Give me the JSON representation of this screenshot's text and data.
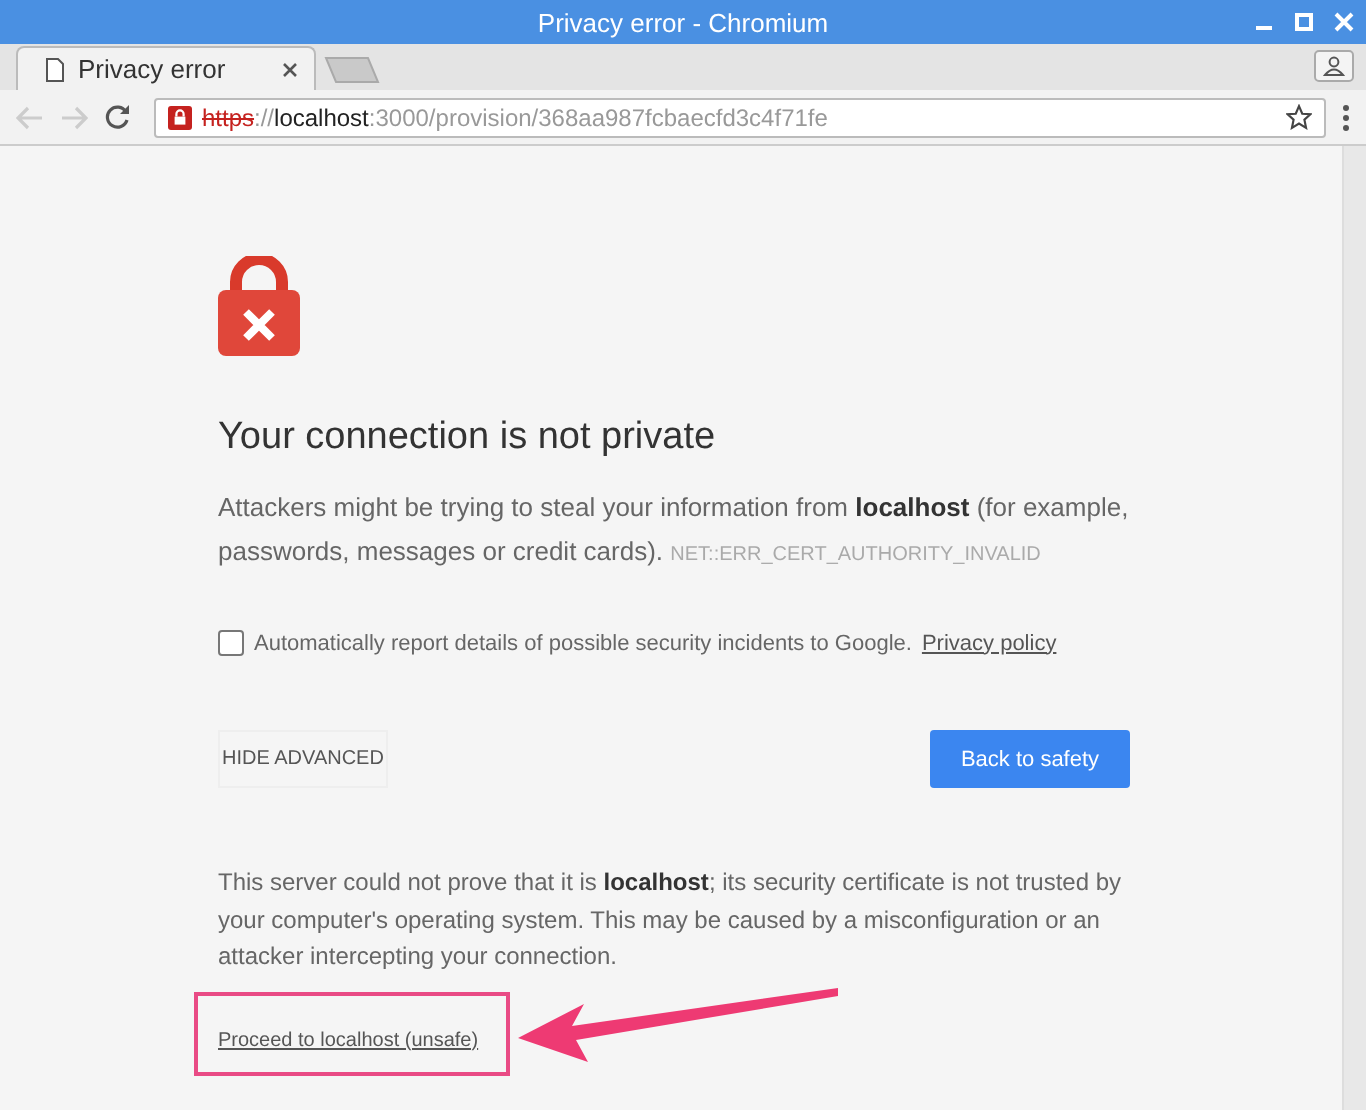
{
  "window": {
    "title": "Privacy error - Chromium"
  },
  "tabs": [
    {
      "label": "Privacy error",
      "selected": true
    }
  ],
  "address_bar": {
    "parts": [
      {
        "kind": "scheme",
        "text": "https"
      },
      {
        "kind": "dim",
        "text": "://"
      },
      {
        "kind": "host",
        "text": "localhost"
      },
      {
        "kind": "dim",
        "text": ":3000/provision/368aa987fcbaecfd3c4f71fe"
      }
    ]
  },
  "page": {
    "heading": "Your connection is not private",
    "intro": "Attackers might be trying to steal your information from **localhost** (for example, passwords, messages or credit cards).",
    "error_code": "NET::ERR_CERT_AUTHORITY_INVALID",
    "report": {
      "label": "Automatically report details of possible security incidents to Google.",
      "link": "Privacy policy",
      "checked": false
    },
    "hide_advanced": "HIDE ADVANCED",
    "back_button": "Back to safety",
    "details": "This server could not prove that it is **localhost**; its security certificate is not trusted by your computer's operating system. This may be caused by a misconfiguration or an attacker intercepting your connection.",
    "proceed_link": "Proceed to localhost (unsafe)"
  }
}
